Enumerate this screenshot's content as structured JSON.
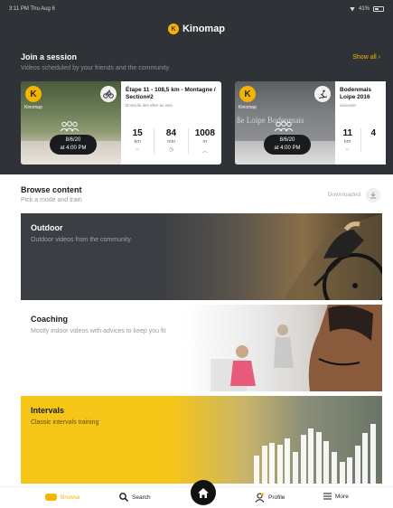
{
  "status": {
    "time": "3:11 PM  Thu Aug 6",
    "battery": "41%"
  },
  "app": {
    "name": "Kinomap"
  },
  "join": {
    "title": "Join a session",
    "subtitle": "Videos scheduled by your friends and the community",
    "show_all": "Show all",
    "sessions": [
      {
        "badge_letter": "K",
        "badge_label": "Kinomap",
        "sport_icon": "bike-icon",
        "date": "8/6/20",
        "time": "at 4:00 PM",
        "title": "Étape 11 - 108,5 km - Montagne / Section#2",
        "subtitle": "Domicile des elles au velo",
        "stats": [
          {
            "value": "15",
            "unit": "km",
            "icon": "↔"
          },
          {
            "value": "84",
            "unit": "min",
            "icon": "◷"
          },
          {
            "value": "1008",
            "unit": "m",
            "icon": "︿"
          }
        ]
      },
      {
        "badge_letter": "K",
        "badge_label": "Kinomap",
        "sport_icon": "skier-icon",
        "date": "8/6/20",
        "time": "at 4:00 PM",
        "watermark": "ße Loipe Bodenmais",
        "title": "Bodenmais Loipe 2016",
        "subtitle": "saisonier",
        "stats": [
          {
            "value": "11",
            "unit": "km",
            "icon": "↔"
          },
          {
            "value": "4",
            "unit": "",
            "icon": ""
          }
        ]
      }
    ]
  },
  "browse": {
    "title": "Browse content",
    "subtitle": "Pick a mode and train",
    "downloaded": "Downloaded",
    "tiles": [
      {
        "title": "Outdoor",
        "subtitle": "Outdoor videos from the community"
      },
      {
        "title": "Coaching",
        "subtitle": "Mostly indoor videos with advices to keep you fit"
      },
      {
        "title": "Intervals",
        "subtitle": "Classic intervals training"
      }
    ],
    "interval_bars": [
      0.45,
      0.6,
      0.65,
      0.62,
      0.72,
      0.5,
      0.78,
      0.88,
      0.82,
      0.68,
      0.5,
      0.35,
      0.42,
      0.6,
      0.8,
      0.95
    ]
  },
  "nav": {
    "browse": "Browse",
    "search": "Search",
    "profile": "Profile",
    "more": "More"
  },
  "colors": {
    "accent": "#f5b400",
    "header_bg": "#2f3237",
    "intervals": "#f5c518"
  }
}
